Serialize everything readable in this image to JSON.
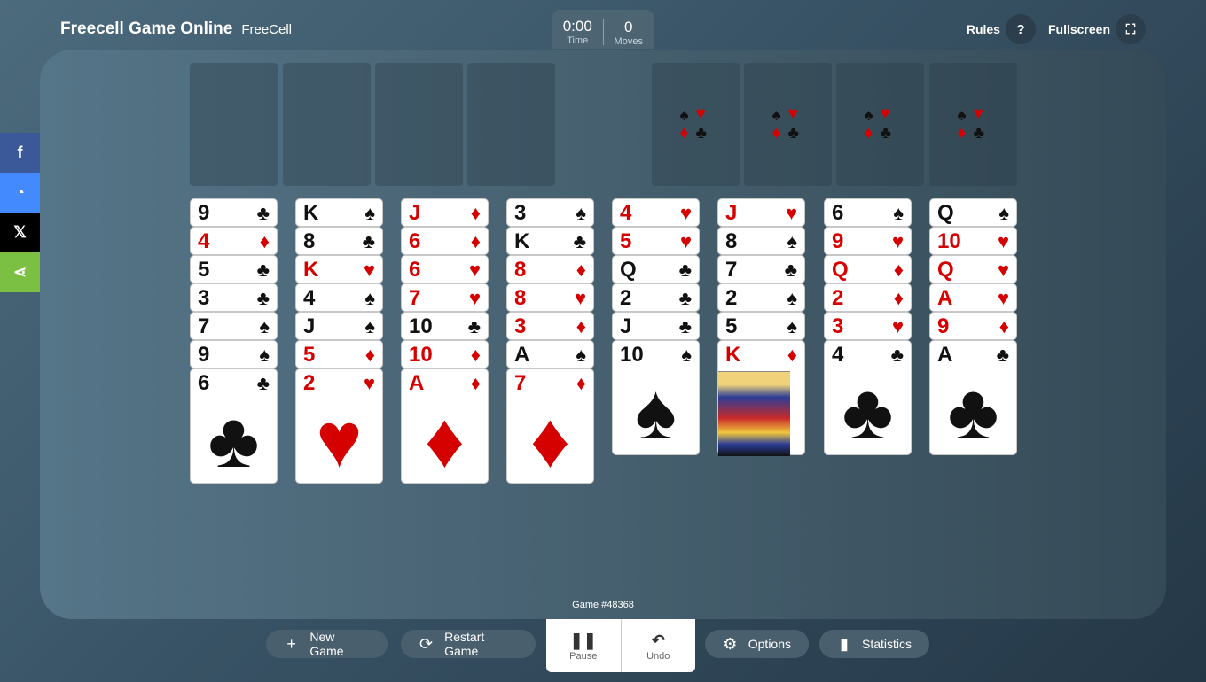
{
  "header": {
    "title": "Freecell Game Online",
    "subtitle": "FreeCell"
  },
  "timer": {
    "time": "0:00",
    "time_label": "Time",
    "moves": "0",
    "moves_label": "Moves"
  },
  "top_buttons": {
    "rules": "Rules",
    "fullscreen": "Fullscreen"
  },
  "social": [
    "facebook-icon",
    "messenger-icon",
    "x-icon",
    "share-icon"
  ],
  "columns": [
    [
      {
        "r": "9",
        "s": "♣",
        "c": "black"
      },
      {
        "r": "4",
        "s": "♦",
        "c": "red"
      },
      {
        "r": "5",
        "s": "♣",
        "c": "black"
      },
      {
        "r": "3",
        "s": "♣",
        "c": "black"
      },
      {
        "r": "7",
        "s": "♠",
        "c": "black"
      },
      {
        "r": "9",
        "s": "♠",
        "c": "black"
      },
      {
        "r": "6",
        "s": "♣",
        "c": "black"
      }
    ],
    [
      {
        "r": "K",
        "s": "♠",
        "c": "black"
      },
      {
        "r": "8",
        "s": "♣",
        "c": "black"
      },
      {
        "r": "K",
        "s": "♥",
        "c": "red"
      },
      {
        "r": "4",
        "s": "♠",
        "c": "black"
      },
      {
        "r": "J",
        "s": "♠",
        "c": "black"
      },
      {
        "r": "5",
        "s": "♦",
        "c": "red"
      },
      {
        "r": "2",
        "s": "♥",
        "c": "red"
      }
    ],
    [
      {
        "r": "J",
        "s": "♦",
        "c": "red"
      },
      {
        "r": "6",
        "s": "♦",
        "c": "red"
      },
      {
        "r": "6",
        "s": "♥",
        "c": "red"
      },
      {
        "r": "7",
        "s": "♥",
        "c": "red"
      },
      {
        "r": "10",
        "s": "♣",
        "c": "black"
      },
      {
        "r": "10",
        "s": "♦",
        "c": "red"
      },
      {
        "r": "A",
        "s": "♦",
        "c": "red"
      }
    ],
    [
      {
        "r": "3",
        "s": "♠",
        "c": "black"
      },
      {
        "r": "K",
        "s": "♣",
        "c": "black"
      },
      {
        "r": "8",
        "s": "♦",
        "c": "red"
      },
      {
        "r": "8",
        "s": "♥",
        "c": "red"
      },
      {
        "r": "3",
        "s": "♦",
        "c": "red"
      },
      {
        "r": "A",
        "s": "♠",
        "c": "black"
      },
      {
        "r": "7",
        "s": "♦",
        "c": "red"
      }
    ],
    [
      {
        "r": "4",
        "s": "♥",
        "c": "red"
      },
      {
        "r": "5",
        "s": "♥",
        "c": "red"
      },
      {
        "r": "Q",
        "s": "♣",
        "c": "black"
      },
      {
        "r": "2",
        "s": "♣",
        "c": "black"
      },
      {
        "r": "J",
        "s": "♣",
        "c": "black"
      },
      {
        "r": "10",
        "s": "♠",
        "c": "black"
      }
    ],
    [
      {
        "r": "J",
        "s": "♥",
        "c": "red"
      },
      {
        "r": "8",
        "s": "♠",
        "c": "black"
      },
      {
        "r": "7",
        "s": "♣",
        "c": "black"
      },
      {
        "r": "2",
        "s": "♠",
        "c": "black"
      },
      {
        "r": "5",
        "s": "♠",
        "c": "black"
      },
      {
        "r": "K",
        "s": "♦",
        "c": "red",
        "face": true
      }
    ],
    [
      {
        "r": "6",
        "s": "♠",
        "c": "black"
      },
      {
        "r": "9",
        "s": "♥",
        "c": "red"
      },
      {
        "r": "Q",
        "s": "♦",
        "c": "red"
      },
      {
        "r": "2",
        "s": "♦",
        "c": "red"
      },
      {
        "r": "3",
        "s": "♥",
        "c": "red"
      },
      {
        "r": "4",
        "s": "♣",
        "c": "black"
      }
    ],
    [
      {
        "r": "Q",
        "s": "♠",
        "c": "black"
      },
      {
        "r": "10",
        "s": "♥",
        "c": "red"
      },
      {
        "r": "Q",
        "s": "♥",
        "c": "red"
      },
      {
        "r": "A",
        "s": "♥",
        "c": "red"
      },
      {
        "r": "9",
        "s": "♦",
        "c": "red"
      },
      {
        "r": "A",
        "s": "♣",
        "c": "black"
      }
    ]
  ],
  "game_number": "Game #48368",
  "bottom": {
    "new_game": "New Game",
    "restart_game": "Restart Game",
    "pause": "Pause",
    "undo": "Undo",
    "options": "Options",
    "statistics": "Statistics"
  }
}
